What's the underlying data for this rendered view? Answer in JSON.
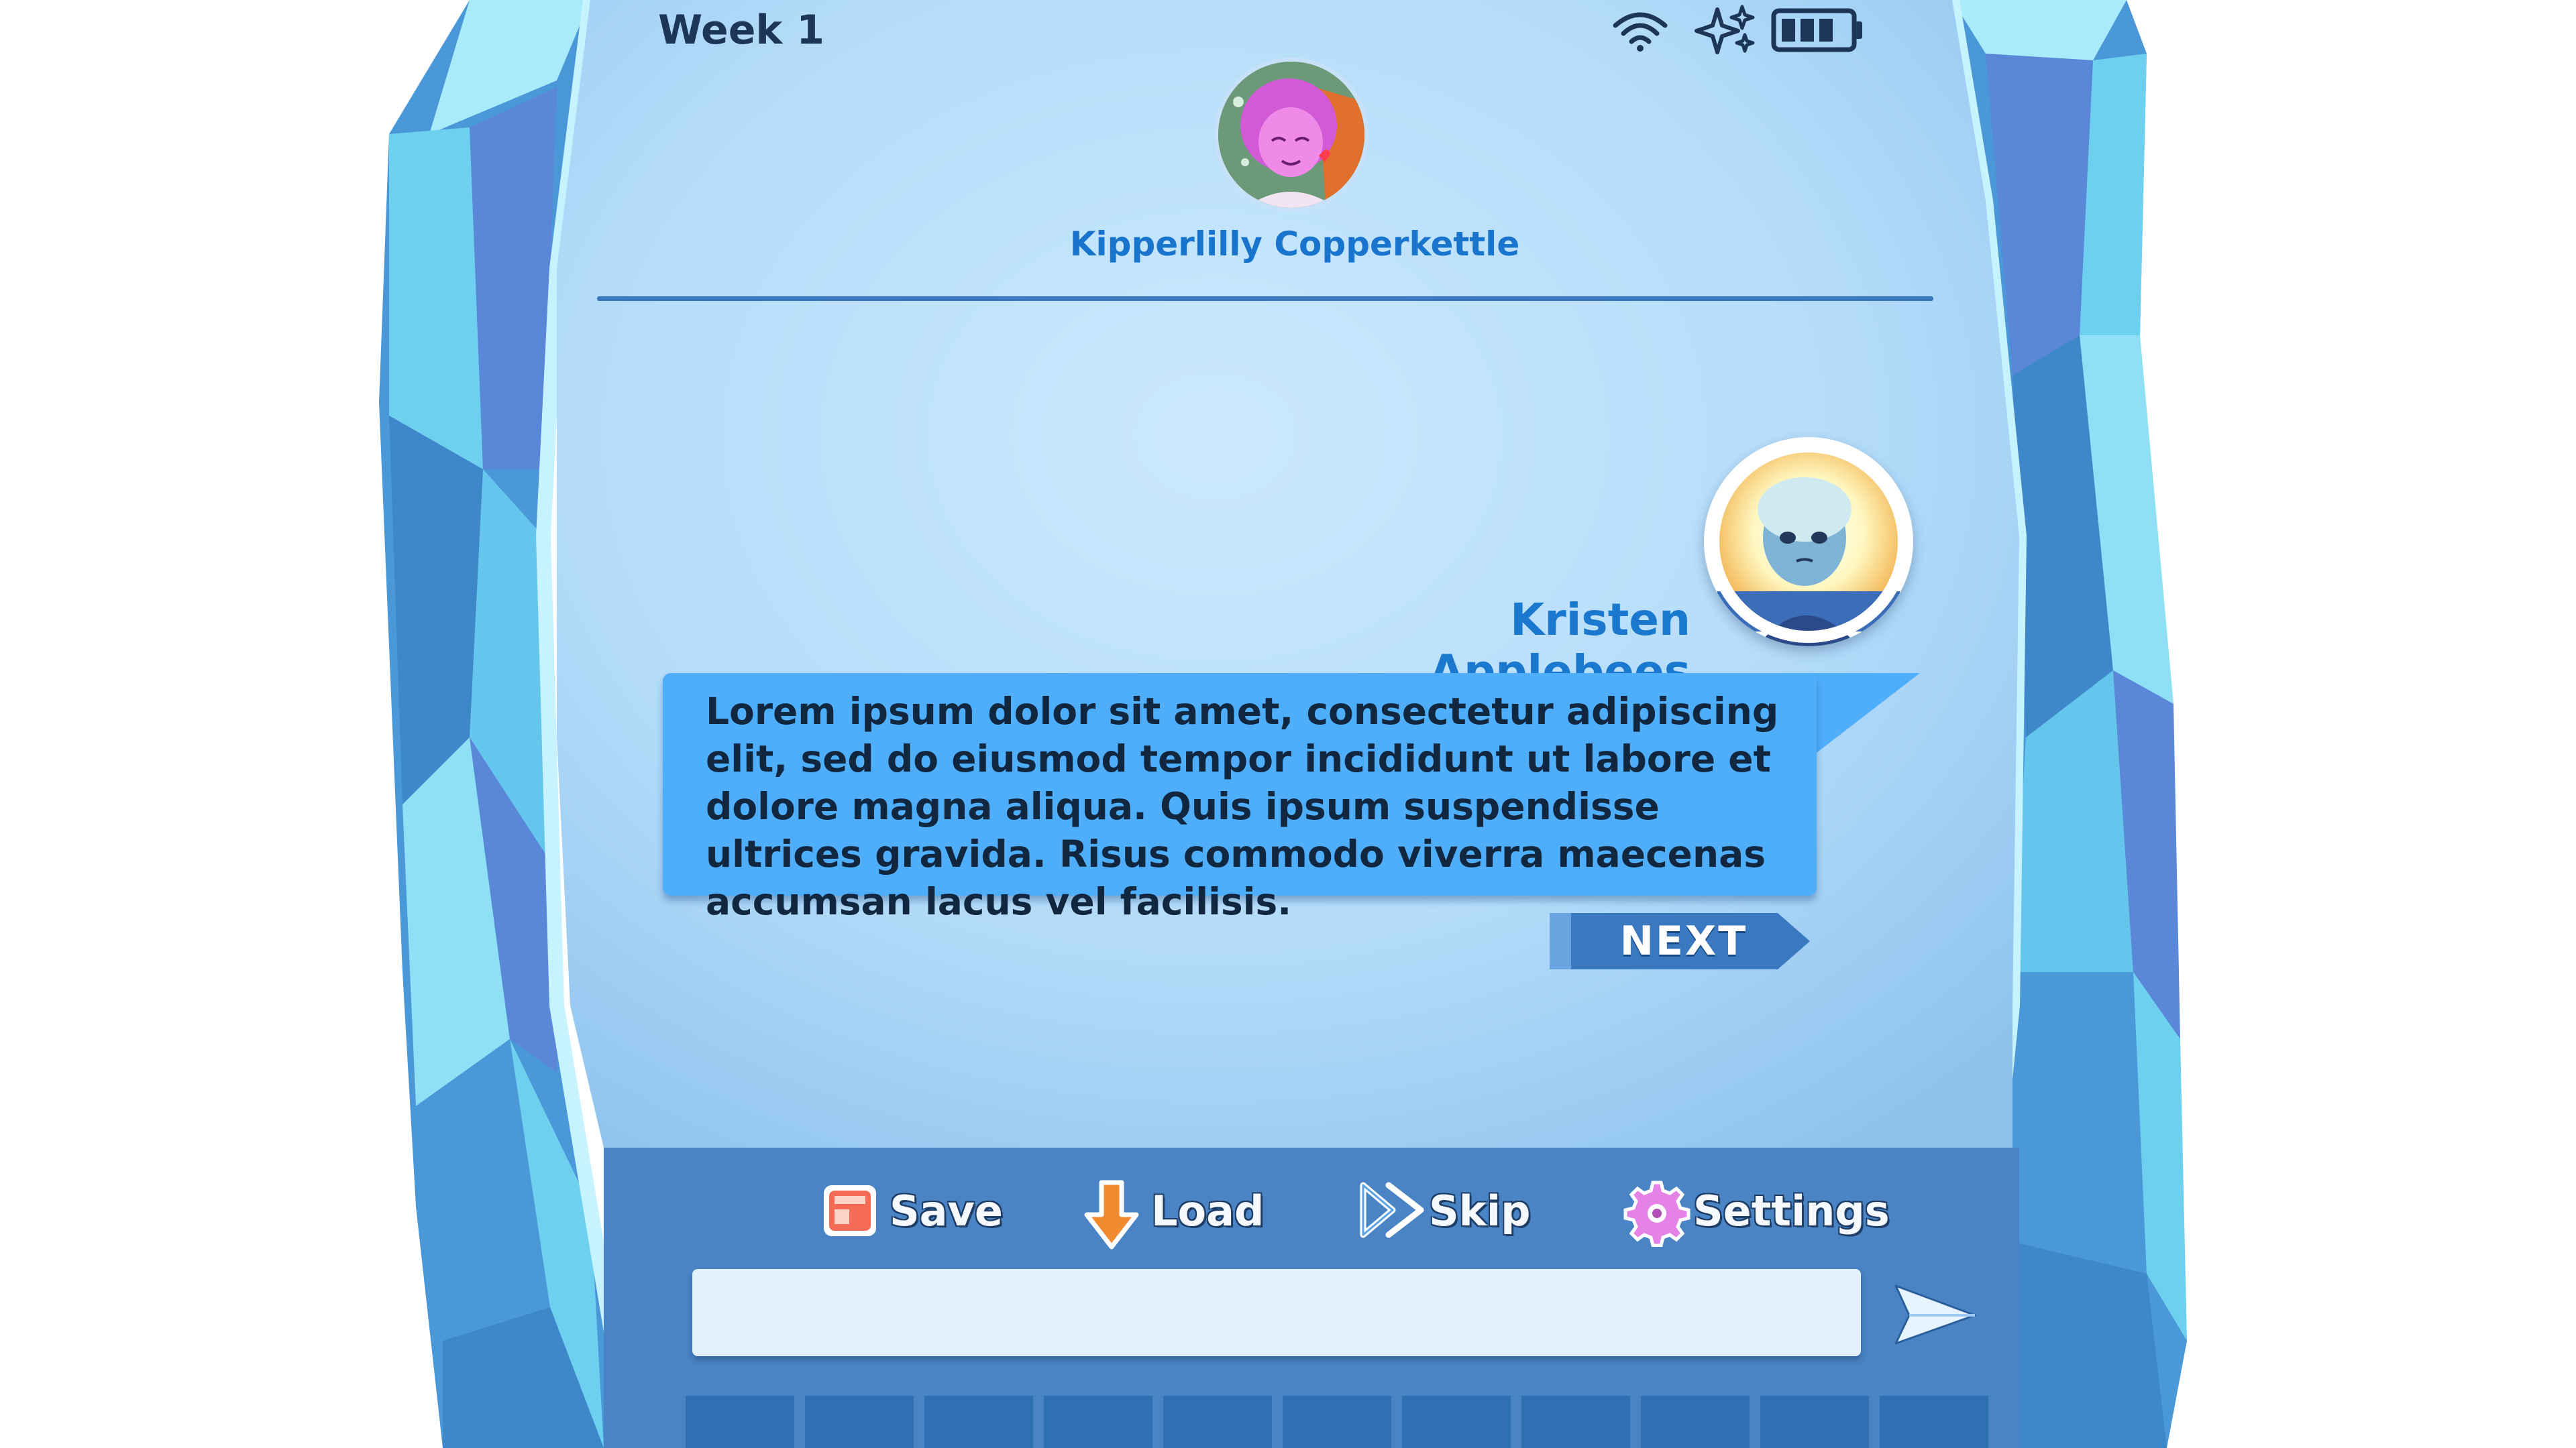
{
  "status_bar": {
    "week_label": "Week 1",
    "icons": [
      "wifi-icon",
      "sparkle-icon",
      "battery-icon"
    ]
  },
  "contact": {
    "name": "Kipperlilly Copperkettle",
    "avatar": "pink-haired-character-avatar"
  },
  "message": {
    "speaker_name": "Kristen Applebees",
    "speaker_avatar": "blue-glowing-character-avatar",
    "text": "Lorem ipsum dolor sit amet, consectetur adipiscing elit, sed do eiusmod tempor incididunt ut labore et dolore magna aliqua. Quis ipsum suspendisse ultrices gravida. Risus commodo viverra maecenas accumsan lacus vel facilisis.",
    "next_label": "NEXT"
  },
  "menu": {
    "items": [
      {
        "label": "Save",
        "icon": "save-icon"
      },
      {
        "label": "Load",
        "icon": "load-arrow-icon"
      },
      {
        "label": "Skip",
        "icon": "skip-icon"
      },
      {
        "label": "Settings",
        "icon": "gear-icon"
      }
    ]
  },
  "input": {
    "value": "",
    "placeholder": "",
    "send_icon": "send-icon"
  },
  "colors": {
    "screen_light": "#c7e6fc",
    "screen_edge": "#8fc3ee",
    "bubble": "#4faefa",
    "accent_text": "#1874cc",
    "panel": "#4a84c4",
    "key": "#2f70b3",
    "crystal_dark": "#5a87d8",
    "crystal_light": "#a9ebfb"
  },
  "key_count": 11
}
